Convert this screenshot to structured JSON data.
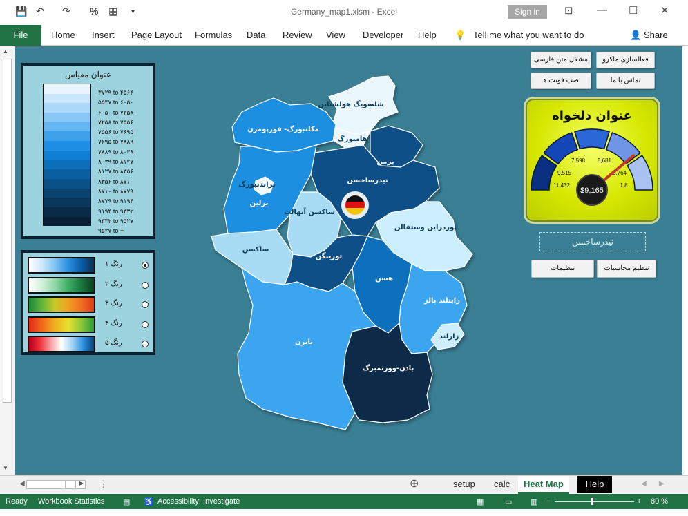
{
  "window": {
    "title": "Germany_map1.xlsm  -  Excel",
    "signin_label": "Sign in",
    "minimize_icon": "—",
    "restore_icon": "☐",
    "close_icon": "✕"
  },
  "ribbon": {
    "tabs": [
      "File",
      "Home",
      "Insert",
      "Page Layout",
      "Formulas",
      "Data",
      "Review",
      "View",
      "Developer",
      "Help"
    ],
    "tell_me": "Tell me what you want to do",
    "share": "Share"
  },
  "legend": {
    "title": "عنوان مقیاس",
    "ranges": [
      "۳۷۲۹ to ۴۵۶۴",
      "۵۵۴۷ to ۶۰۵۰",
      "۶۰۵۰ to ۷۲۵۸",
      "۷۲۵۸ to ۷۵۵۶",
      "۷۵۵۶ to ۷۶۹۵",
      "۷۶۹۵ to ۷۸۸۹",
      "۷۸۸۹ to ۸۰۳۹",
      "۸۰۳۹ to ۸۱۲۷",
      "۸۱۲۷ to ۸۳۵۶",
      "۸۳۵۶ to ۸۷۱۰",
      "۸۷۱۰ to ۸۷۷۹",
      "۸۷۷۹ to ۹۱۹۴",
      "۹۱۹۴ to ۹۳۳۲",
      "۹۳۳۲ to ۹۵۲۷",
      "۹۵۲۷ to +"
    ],
    "ramp_colors": [
      "#e8f5ff",
      "#c9e6fb",
      "#a9d8f9",
      "#87c8f6",
      "#63b6f1",
      "#3ea2ec",
      "#1e8fe4",
      "#0f7fd3",
      "#0b6fba",
      "#0a5fa0",
      "#0a5187",
      "#0a4370",
      "#0a375c",
      "#092b48",
      "#081f36"
    ]
  },
  "themes": [
    {
      "label": "رنگ ۱",
      "selected": true,
      "gradient": "linear-gradient(90deg,#ffffff,#cfe9fb,#7fc3f3,#2b90e0,#0b5fa6,#0a2f52)"
    },
    {
      "label": "رنگ ۲",
      "selected": false,
      "gradient": "linear-gradient(90deg,#ffffff,#d2f0dc,#8fd6a6,#3fae66,#1a7a3e,#0b3d22)"
    },
    {
      "label": "رنگ ۳",
      "selected": false,
      "gradient": "linear-gradient(90deg,#1a8a3a,#62b53a,#c9c92a,#f0a020,#f07020,#e03a1a)"
    },
    {
      "label": "رنگ ۴",
      "selected": false,
      "gradient": "linear-gradient(90deg,#e02a1a,#f06a1a,#f0b020,#e8e030,#8fc83a,#2a9a3a)"
    },
    {
      "label": "رنگ ۵",
      "selected": false,
      "gradient": "linear-gradient(90deg,#b3001a,#f0303a,#f6a0a0,#ffffff,#a0d4f6,#2b90e0,#0a3f7a)"
    }
  ],
  "map": {
    "states": [
      {
        "name": "شلسویگ هولشتاین",
        "color": "#e9f6fc",
        "dark": true
      },
      {
        "name": "هامبورگ",
        "color": "#e9f6fc",
        "dark": true
      },
      {
        "name": "مکلنبورگ- فورپومرن",
        "color": "#1a8fe0",
        "dark": false
      },
      {
        "name": "برمن",
        "color": "#0c4f86",
        "dark": false
      },
      {
        "name": "نیدرساخسن",
        "color": "#0c4f86",
        "dark": false
      },
      {
        "name": "برلین",
        "color": "#1a8fe0",
        "dark": false
      },
      {
        "name": "براندنبورگ",
        "color": "#f3fbff",
        "dark": true
      },
      {
        "name": "ساکسن آنهالت",
        "color": "#a8dcf5",
        "dark": true
      },
      {
        "name": "ساکسن",
        "color": "#a8dcf5",
        "dark": true
      },
      {
        "name": "نوردراین وستفالن",
        "color": "#cdeefc",
        "dark": true
      },
      {
        "name": "تورینگن",
        "color": "#0c4f86",
        "dark": false
      },
      {
        "name": "هسن",
        "color": "#1170bd",
        "dark": false
      },
      {
        "name": "راینلند پالز",
        "color": "#3aa6ef",
        "dark": false
      },
      {
        "name": "زارلند",
        "color": "#cdeefc",
        "dark": true
      },
      {
        "name": "بایرن",
        "color": "#3aa6ef",
        "dark": false
      },
      {
        "name": "بادن-وورتمبرگ",
        "color": "#082b48",
        "dark": false
      }
    ]
  },
  "buttons": {
    "macro": "فعالسازی ماکرو",
    "persian_text": "مشکل متن فارسی",
    "contact": "تماس با ما",
    "install_font": "نصب فونت ها",
    "calc_settings": "تنظیم محاسبات",
    "settings": "تنظیمات"
  },
  "gauge": {
    "title": "عنوان دلخواه",
    "value_label": "$9,165",
    "ticks": [
      "11,432",
      "9,515",
      "7,598",
      "5,681",
      "3,764",
      "1,8"
    ],
    "value": 9165,
    "min": 1800,
    "max": 11432
  },
  "selected_region": "نیدرساخسن",
  "sheet_tabs": [
    "setup",
    "calc",
    "Heat Map",
    "Help"
  ],
  "active_tab": "Heat Map",
  "status": {
    "ready": "Ready",
    "workbook_stats": "Workbook Statistics",
    "accessibility": "Accessibility: Investigate",
    "zoom": "80 %"
  }
}
